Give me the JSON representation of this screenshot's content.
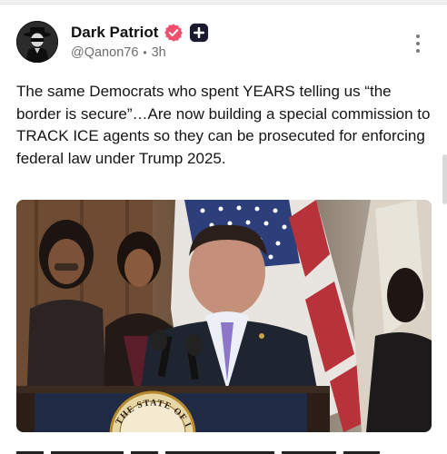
{
  "post": {
    "author": {
      "display_name": "Dark Patriot",
      "handle": "@Qanon76",
      "avatar_icon": "masked-man-avatar",
      "verified_badge_color": "#f0506e",
      "plus_badge_color": "#1a1a2e"
    },
    "separator": "•",
    "time": "3h",
    "text": "The same Democrats who spent YEARS telling us “the border is secure”…Are now building a special commission to TRACK ICE agents so they can be prosecuted for enforcing federal law under Trump 2025.",
    "media": {
      "seal_text": "THE STATE OF IL"
    }
  },
  "icons": {
    "more": "more-vertical-icon",
    "verified": "verified-badge-icon",
    "plus": "plus-badge-icon"
  }
}
